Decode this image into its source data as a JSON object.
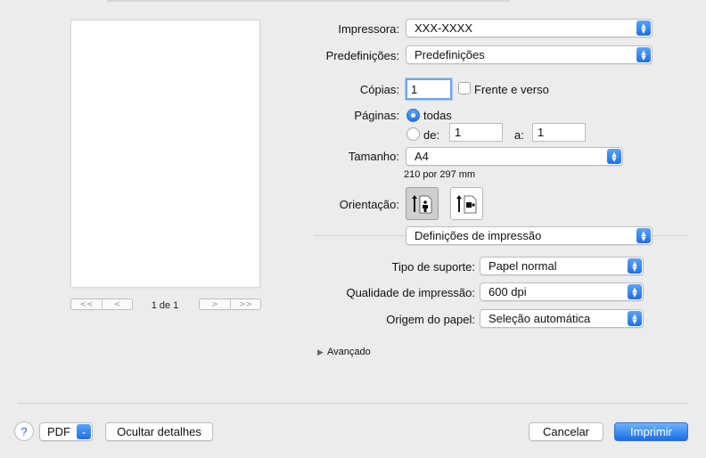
{
  "printer": {
    "label": "Impressora:",
    "value": "XXX-XXXX"
  },
  "presets": {
    "label": "Predefinições:",
    "value": "Predefinições"
  },
  "copies": {
    "label": "Cópias:",
    "value": "1",
    "duplex_label": "Frente e verso"
  },
  "pages": {
    "label": "Páginas:",
    "all_label": "todas",
    "from_label": "de:",
    "from_value": "1",
    "to_label": "a:",
    "to_value": "1"
  },
  "paper_size": {
    "label": "Tamanho:",
    "value": "A4",
    "dimensions": "210 por 297 mm"
  },
  "orientation": {
    "label": "Orientação:",
    "selected": "portrait"
  },
  "section_popup": {
    "value": "Definições de impressão"
  },
  "media_type": {
    "label": "Tipo de suporte:",
    "value": "Papel normal"
  },
  "print_quality": {
    "label": "Qualidade de impressão:",
    "value": "600 dpi"
  },
  "paper_source": {
    "label": "Origem do papel:",
    "value": "Seleção automática"
  },
  "advanced": {
    "label": "Avançado"
  },
  "preview": {
    "page_indicator": "1 de 1",
    "first_icon": "<<",
    "prev_icon": "<",
    "next_icon": ">",
    "last_icon": ">>"
  },
  "footer": {
    "help_icon": "?",
    "pdf_label": "PDF",
    "hide_details_label": "Ocultar detalhes",
    "cancel_label": "Cancelar",
    "print_label": "Imprimir"
  },
  "colors": {
    "accent": "#1f6fe8",
    "background": "#ececec"
  }
}
